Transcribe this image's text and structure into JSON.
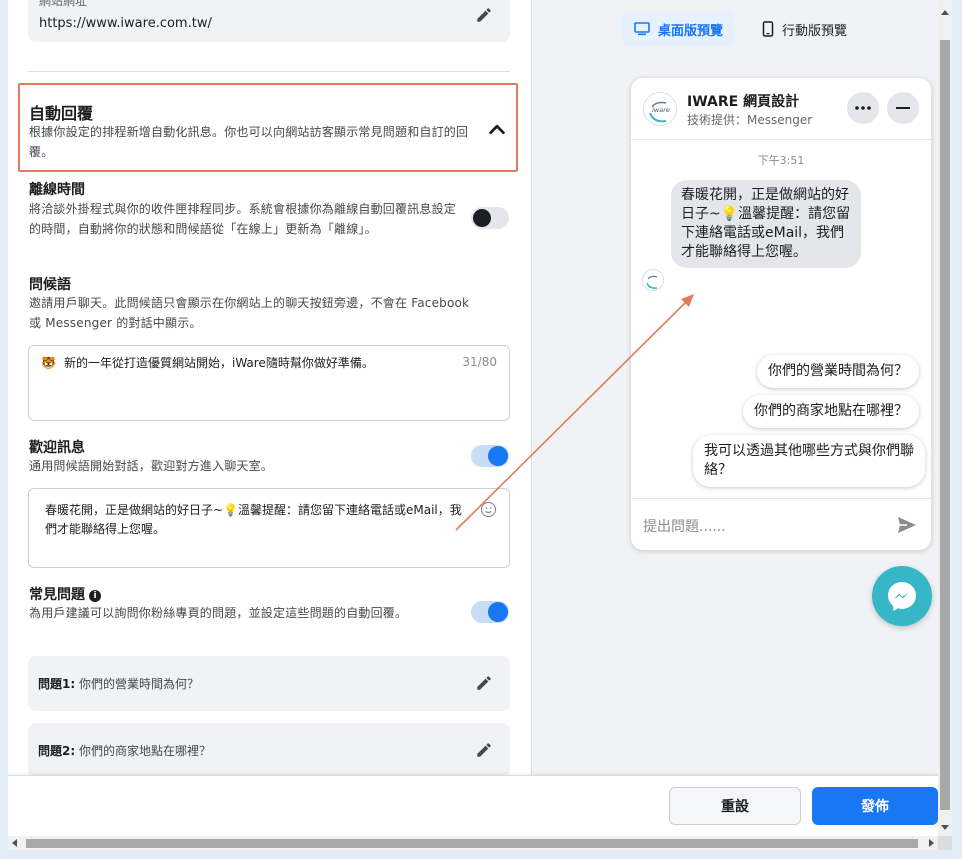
{
  "website": {
    "label_partial": "網站網址",
    "url": "https://www.iware.com.tw/"
  },
  "auto_reply": {
    "title": "自動回覆",
    "description": "根據你設定的排程新增自動化訊息。你也可以向網站訪客顯示常見問題和自訂的回覆。"
  },
  "offline": {
    "title": "離線時間",
    "description": "將洽談外掛程式與你的收件匣排程同步。系統會根據你為離線自動回覆訊息設定的時間，自動將你的狀態和問候語從「在線上」更新為「離線」。",
    "enabled": false
  },
  "greeting": {
    "title": "問候語",
    "description": "邀請用戶聊天。此問候語只會顯示在你網站上的聊天按鈕旁邊，不會在 Facebook 或 Messenger 的對話中顯示。",
    "text": "新的一年從打造優質網站開始，iWare隨時幫你做好準備。",
    "counter": "31/80",
    "emoji": "🐯"
  },
  "welcome": {
    "title": "歡迎訊息",
    "description": "通用問候語開始對話，歡迎對方進入聊天室。",
    "enabled": true,
    "text": "春暖花開，正是做網站的好日子~💡溫馨提醒：請您留下連絡電話或eMail，我們才能聯絡得上您喔。"
  },
  "faq": {
    "title": "常見問題",
    "description": "為用戶建議可以詢問你粉絲專頁的問題，並設定這些問題的自動回覆。",
    "enabled": true,
    "items": [
      {
        "label": "問題1:",
        "text": "你們的營業時間為何？"
      },
      {
        "label": "問題2:",
        "text": "你們的商家地點在哪裡？"
      }
    ]
  },
  "preview_tabs": {
    "desktop": "桌面版預覽",
    "mobile": "行動版預覽"
  },
  "chat": {
    "page_name": "IWARE 網頁設計",
    "powered_by": "技術提供：Messenger",
    "time": "下午3:51",
    "message": "春暖花開，正是做網站的好日子~💡溫馨提醒：請您留下連絡電話或eMail，我們才能聯絡得上您喔。",
    "quick_replies": [
      "你們的營業時間為何？",
      "你們的商家地點在哪裡？",
      "我可以透過其他哪些方式與你們聯絡？"
    ],
    "input_placeholder": "提出問題......",
    "logo_text": "iware"
  },
  "buttons": {
    "reset": "重設",
    "publish": "發佈"
  },
  "colors": {
    "accent": "#1877f2",
    "highlight_border": "#e07b5f",
    "annotation_arrow": "#e07b5f",
    "messenger_fab": "#37b6c8"
  }
}
